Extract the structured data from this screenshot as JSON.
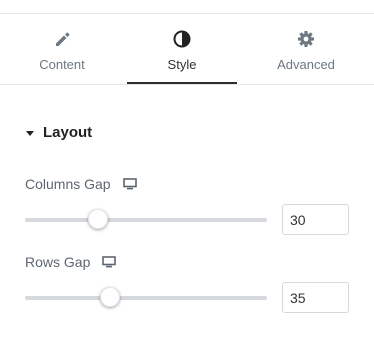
{
  "tabs": [
    {
      "label": "Content",
      "icon": "pencil-icon",
      "active": false
    },
    {
      "label": "Style",
      "icon": "half-circle-icon",
      "active": true
    },
    {
      "label": "Advanced",
      "icon": "gear-icon",
      "active": false
    }
  ],
  "section": {
    "title": "Layout",
    "expanded": true
  },
  "controls": [
    {
      "label": "Columns Gap",
      "device_icon": "desktop-icon",
      "value": "30",
      "slider_fraction": 0.3
    },
    {
      "label": "Rows Gap",
      "device_icon": "desktop-icon",
      "value": "35",
      "slider_fraction": 0.35
    }
  ],
  "colors": {
    "active_tab_underline": "#2d2d2d",
    "track": "#d5d8dc",
    "muted_text": "#6d7882"
  }
}
